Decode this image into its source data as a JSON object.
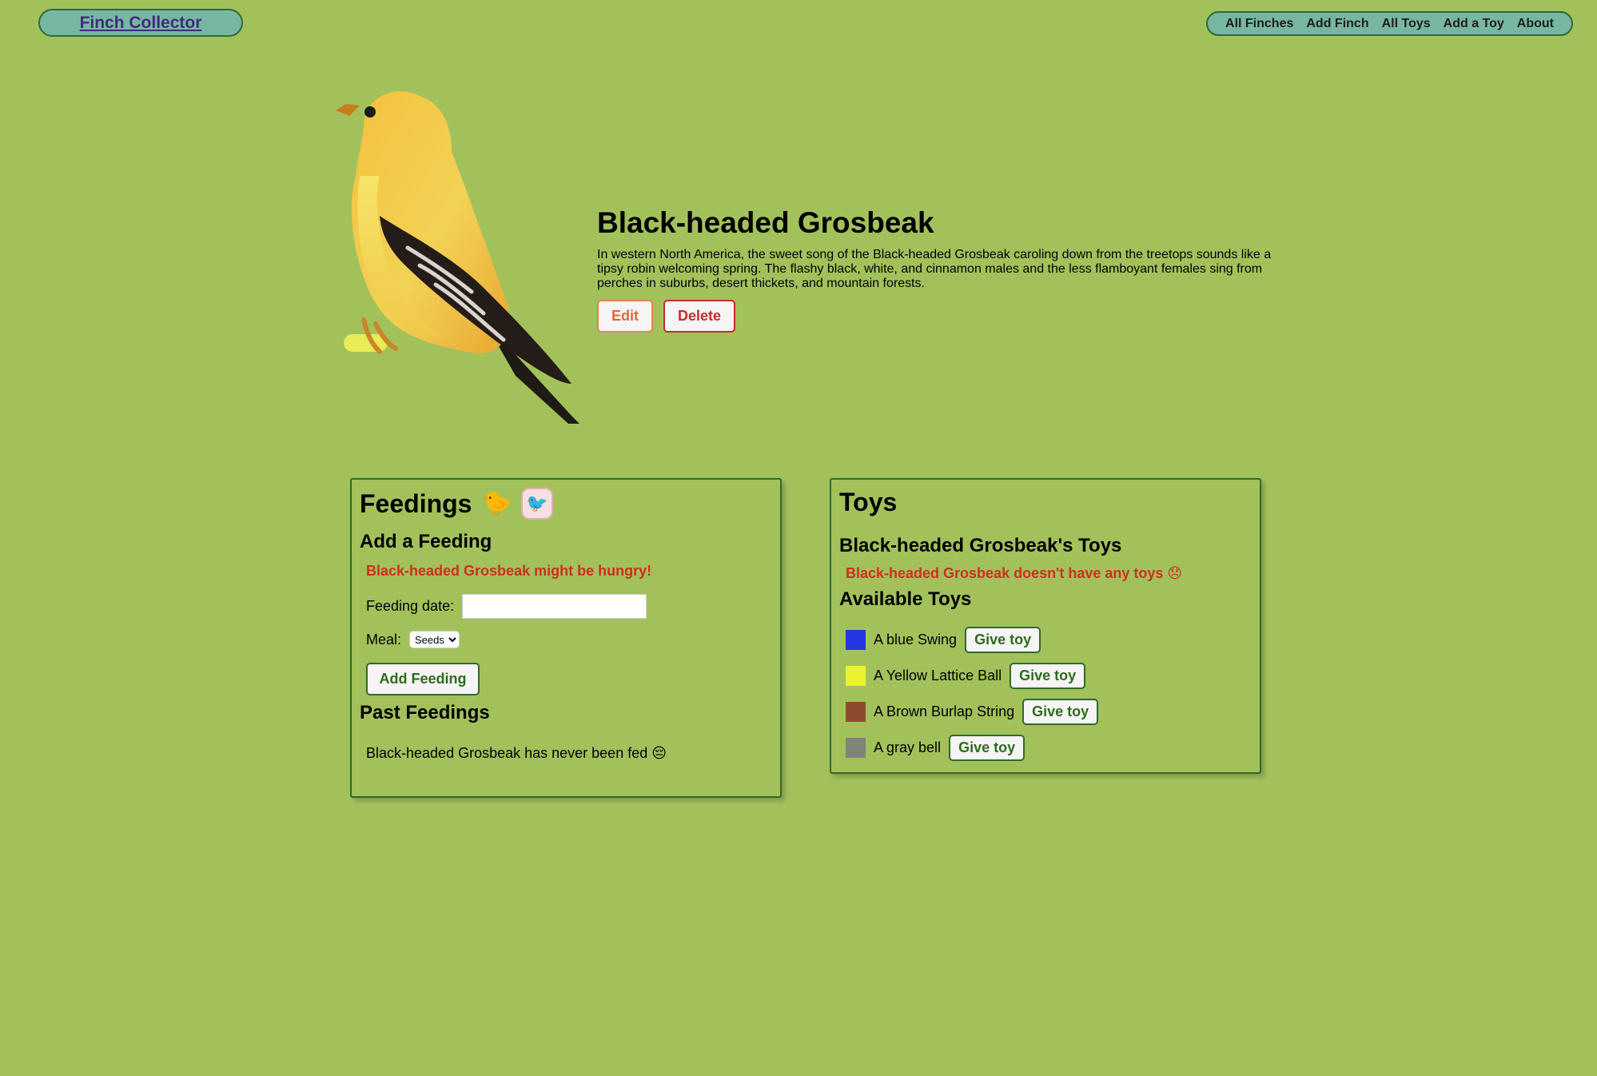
{
  "header": {
    "brand": "Finch Collector",
    "nav": [
      "All Finches",
      "Add Finch",
      "All Toys",
      "Add a Toy",
      "About"
    ]
  },
  "finch": {
    "name": "Black-headed Grosbeak",
    "description": "In western North America, the sweet song of the Black-headed Grosbeak caroling down from the treetops sounds like a tipsy robin welcoming spring. The flashy black, white, and cinnamon males and the less flamboyant females sing from perches in suburbs, desert thickets, and mountain forests.",
    "edit_label": "Edit",
    "delete_label": "Delete"
  },
  "feedings": {
    "title": "Feedings",
    "icons": [
      "bird-emoji-icon",
      "bird-picture-icon"
    ],
    "add_heading": "Add a Feeding",
    "hungry_message": "Black-headed Grosbeak might be hungry!",
    "date_label": "Feeding date:",
    "date_value": "",
    "meal_label": "Meal:",
    "meal_selected": "Seeds",
    "add_button": "Add Feeding",
    "past_heading": "Past Feedings",
    "past_empty": "Black-headed Grosbeak has never been fed 😔"
  },
  "toys": {
    "title": "Toys",
    "owned_heading": "Black-headed Grosbeak's Toys",
    "owned_empty": "Black-headed Grosbeak doesn't have any toys 😞",
    "available_heading": "Available Toys",
    "give_label": "Give toy",
    "available": [
      {
        "name": "A blue Swing",
        "color": "#2336e0"
      },
      {
        "name": "A Yellow Lattice Ball",
        "color": "#ecf22f"
      },
      {
        "name": "A Brown Burlap String",
        "color": "#8f4a2e"
      },
      {
        "name": "A gray bell",
        "color": "#80847a"
      }
    ]
  },
  "colors": {
    "background": "#a3c15b",
    "nav_background": "#78b6a4",
    "border_green": "#2f6a2c",
    "warning_red": "#cd2f22"
  }
}
